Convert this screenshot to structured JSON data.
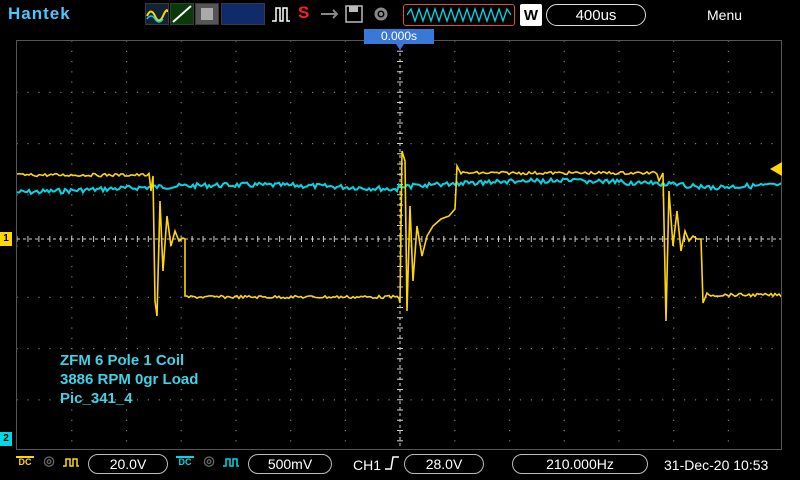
{
  "topbar": {
    "brand": "Hantek",
    "stop_label": "S",
    "waveform_badge": "W",
    "timebase": "400us",
    "menu": "Menu"
  },
  "screen": {
    "trigger_time": "0.000s",
    "ch1_marker": "1",
    "ch2_marker": "2",
    "annotation_lines": [
      "ZFM 6 Pole 1 Coil",
      "3886 RPM  0gr Load",
      "Pic_341_4"
    ]
  },
  "status": {
    "ch1_coupling": "DC",
    "ch1_volts": "20.0V",
    "ch2_coupling": "DC",
    "ch2_volts": "500mV",
    "trigger_source": "CH1",
    "trigger_level": "28.0V",
    "frequency": "210.000Hz",
    "datetime": "31-Dec-20 10:53"
  },
  "colors": {
    "ch1": "#ffd700",
    "ch2": "#00d8e8",
    "brand": "#4fc3ff",
    "accent": "#3a78d8"
  }
}
